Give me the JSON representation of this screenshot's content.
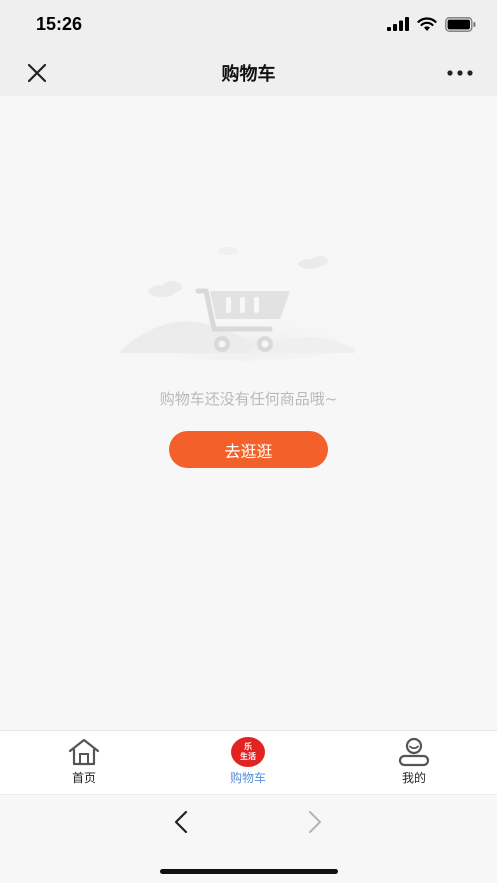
{
  "status": {
    "time": "15:26",
    "icons": [
      "cellular-signal-icon",
      "wifi-icon",
      "battery-icon"
    ]
  },
  "nav": {
    "title": "购物车",
    "close_icon": "close-icon",
    "more_icon": "more-icon"
  },
  "empty_state": {
    "illustration": "empty-cart-icon",
    "message": "购物车还没有任何商品哦~",
    "button_label": "去逛逛"
  },
  "tabs": [
    {
      "label": "首页",
      "icon": "home-icon",
      "active": false
    },
    {
      "label": "购物车",
      "icon": "le-life-logo",
      "badge_text_1": "乐",
      "badge_text_2": "生活",
      "active": true
    },
    {
      "label": "我的",
      "icon": "profile-icon",
      "active": false
    }
  ],
  "browser": {
    "back_icon": "chevron-left-icon",
    "forward_icon": "chevron-right-icon"
  },
  "colors": {
    "accent": "#f3602a",
    "active_tab": "#5a8fd8",
    "badge": "#e32322",
    "empty_text": "#b9b9b9"
  }
}
